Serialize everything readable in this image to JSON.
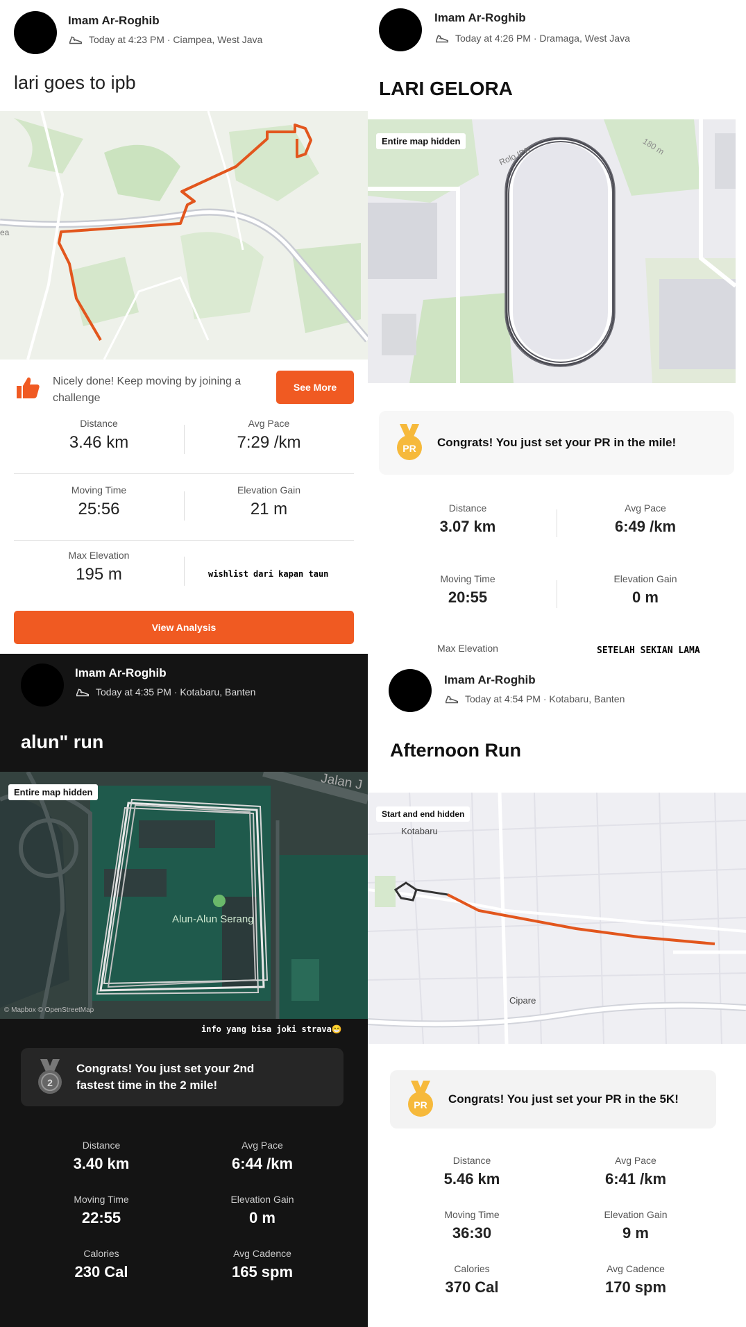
{
  "colors": {
    "strava_orange": "#f05a22",
    "pr_gold": "#f6b93b",
    "dark_bg": "#141414"
  },
  "posts": [
    {
      "user": "Imam Ar-Roghib",
      "meta": "Today at 4:23 PM · Ciampea, West Java",
      "title": "lari goes to ipb",
      "prompt": {
        "text": "Nicely done! Keep moving by joining a challenge",
        "button": "See More"
      },
      "stats": [
        {
          "label": "Distance",
          "value": "3.46 km"
        },
        {
          "label": "Avg Pace",
          "value": "7:29 /km"
        },
        {
          "label": "Moving Time",
          "value": "25:56"
        },
        {
          "label": "Elevation Gain",
          "value": "21 m"
        },
        {
          "label": "Max Elevation",
          "value": "195 m"
        }
      ],
      "overlay_text": "wishlist dari kapan taun",
      "analysis_button": "View Analysis",
      "map_text": "ea"
    },
    {
      "user": "Imam Ar-Roghib",
      "meta": "Today at 4:26 PM · Dramaga, West Java",
      "title": "LARI GELORA",
      "map_label": "Entire map hidden",
      "map_text": {
        "road": "Rolo IPB",
        "distance": "180 m"
      },
      "pr": {
        "badge": "PR",
        "text": "Congrats! You just set your PR in the mile!"
      },
      "stats": [
        {
          "label": "Distance",
          "value": "3.07 km"
        },
        {
          "label": "Avg Pace",
          "value": "6:49 /km"
        },
        {
          "label": "Moving Time",
          "value": "20:55"
        },
        {
          "label": "Elevation Gain",
          "value": "0 m"
        },
        {
          "label": "Max Elevation",
          "value": ""
        }
      ],
      "overlay_text": "SETELAH SEKIAN LAMA"
    },
    {
      "user": "Imam Ar-Roghib",
      "meta": "Today at 4:35 PM · Kotabaru, Banten",
      "title": "alun\" run",
      "map_label": "Entire map hidden",
      "map_text": {
        "road": "Jalan J",
        "place": "Alun-Alun Serang",
        "attribution": "© Mapbox © OpenStreetMap"
      },
      "overlay_text": "info yang bisa joki strava😁",
      "pr": {
        "badge": "2",
        "text": "Congrats! You just set your 2nd fastest time in the 2 mile!"
      },
      "stats": [
        {
          "label": "Distance",
          "value": "3.40 km"
        },
        {
          "label": "Avg Pace",
          "value": "6:44 /km"
        },
        {
          "label": "Moving Time",
          "value": "22:55"
        },
        {
          "label": "Elevation Gain",
          "value": "0 m"
        },
        {
          "label": "Calories",
          "value": "230 Cal"
        },
        {
          "label": "Avg Cadence",
          "value": "165 spm"
        }
      ]
    },
    {
      "user": "Imam Ar-Roghib",
      "meta": "Today at 4:54 PM · Kotabaru, Banten",
      "title": "Afternoon Run",
      "map_label": "Start and end hidden",
      "map_text": {
        "place1": "Kotabaru",
        "place2": "Cipare"
      },
      "pr": {
        "badge": "PR",
        "text": "Congrats! You just set your PR in the 5K!"
      },
      "stats": [
        {
          "label": "Distance",
          "value": "5.46 km"
        },
        {
          "label": "Avg Pace",
          "value": "6:41 /km"
        },
        {
          "label": "Moving Time",
          "value": "36:30"
        },
        {
          "label": "Elevation Gain",
          "value": "9 m"
        },
        {
          "label": "Calories",
          "value": "370 Cal"
        },
        {
          "label": "Avg Cadence",
          "value": "170 spm"
        }
      ]
    }
  ]
}
